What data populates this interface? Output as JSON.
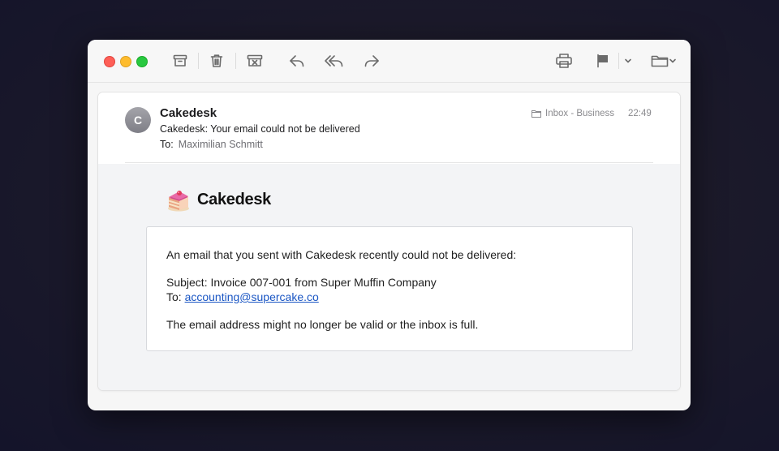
{
  "toolbar": {
    "buttons": [
      "archive-icon",
      "trash-icon",
      "junk-icon",
      "reply-icon",
      "reply-all-icon",
      "forward-icon",
      "print-icon",
      "flag-icon",
      "move-to-folder-icon"
    ]
  },
  "email": {
    "avatar_letter": "C",
    "sender": "Cakedesk",
    "subject": "Cakedesk: Your email could not be delivered",
    "to_label": "To:",
    "to_name": "Maximilian Schmitt",
    "mailbox": "Inbox - Business",
    "time": "22:49"
  },
  "content": {
    "brand_name": "Cakedesk",
    "intro": "An email that you sent with Cakedesk recently could not be delivered:",
    "subject_line": "Subject: Invoice 007-001 from Super Muffin Company",
    "to_label": "To:",
    "to_email": "accounting@supercake.co",
    "note": "The email address might no longer be valid or the inbox is full."
  },
  "colors": {
    "link": "#1a56c4",
    "traffic_red": "#fe5f57",
    "traffic_yellow": "#febc2e",
    "traffic_green": "#28c840"
  }
}
